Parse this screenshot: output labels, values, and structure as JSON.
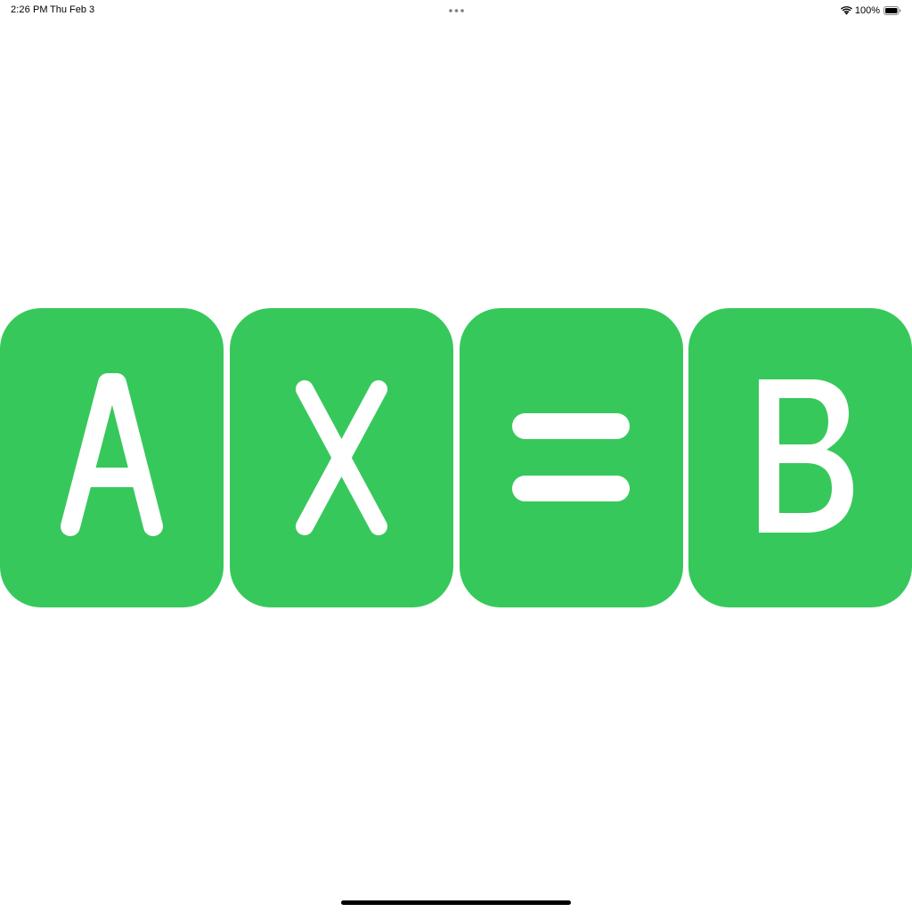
{
  "status_bar": {
    "time": "2:26 PM",
    "date": "Thu Feb 3",
    "battery_percent": "100%",
    "wifi_icon": "wifi-icon",
    "battery_icon": "battery-full-icon",
    "multitask_icon": "ellipsis-icon"
  },
  "tiles": [
    {
      "label": "A",
      "glyph": "letter-a"
    },
    {
      "label": "X",
      "glyph": "letter-x"
    },
    {
      "label": "=",
      "glyph": "equals-sign"
    },
    {
      "label": "B",
      "glyph": "letter-b"
    }
  ],
  "colors": {
    "tile_background": "#37c85b",
    "tile_foreground": "#ffffff",
    "background": "#ffffff",
    "home_indicator": "#000000"
  }
}
